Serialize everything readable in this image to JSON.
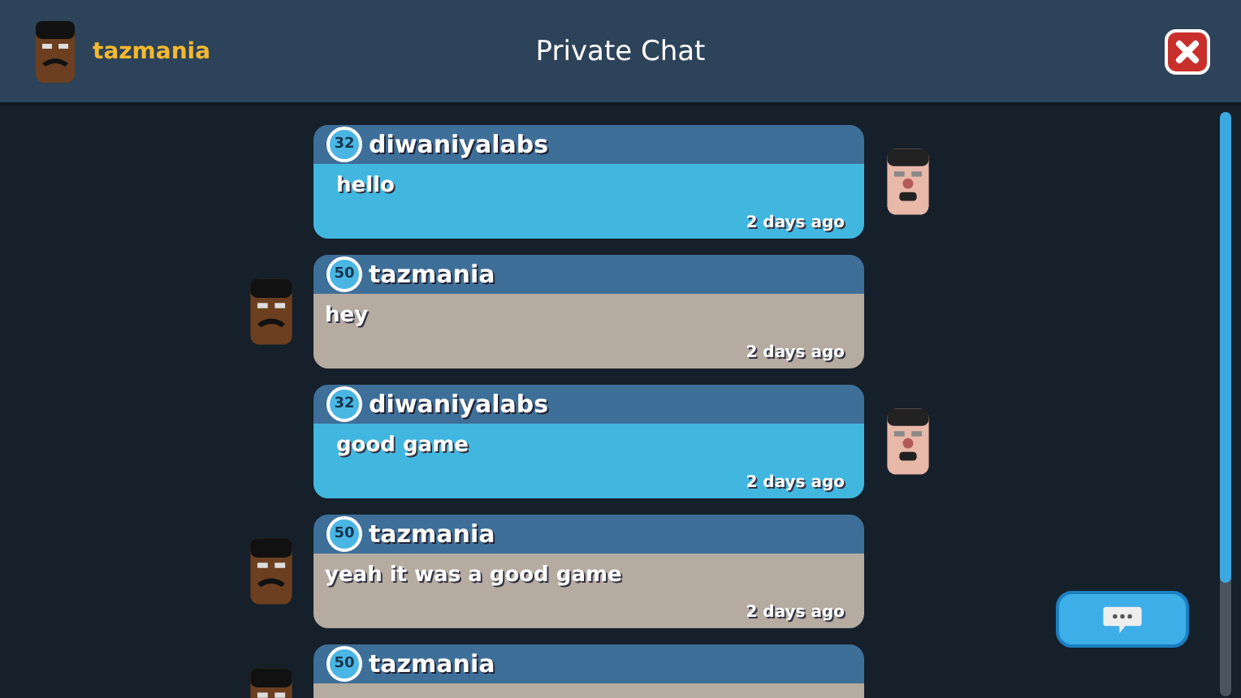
{
  "header": {
    "username": "tazmania",
    "title": "Private Chat"
  },
  "messages": [
    {
      "kind": "mine",
      "level_badge": "32",
      "sender": "diwaniyalabs",
      "text": "hello",
      "time": "2 days ago"
    },
    {
      "kind": "theirs",
      "level_badge": "50",
      "sender": "tazmania",
      "text": "hey",
      "time": "2 days ago"
    },
    {
      "kind": "mine",
      "level_badge": "32",
      "sender": "diwaniyalabs",
      "text": "good game",
      "time": "2 days ago"
    },
    {
      "kind": "theirs",
      "level_badge": "50",
      "sender": "tazmania",
      "text": "yeah it was a good game",
      "time": "2 days ago"
    },
    {
      "kind": "theirs",
      "level_badge": "50",
      "sender": "tazmania"
    }
  ]
}
